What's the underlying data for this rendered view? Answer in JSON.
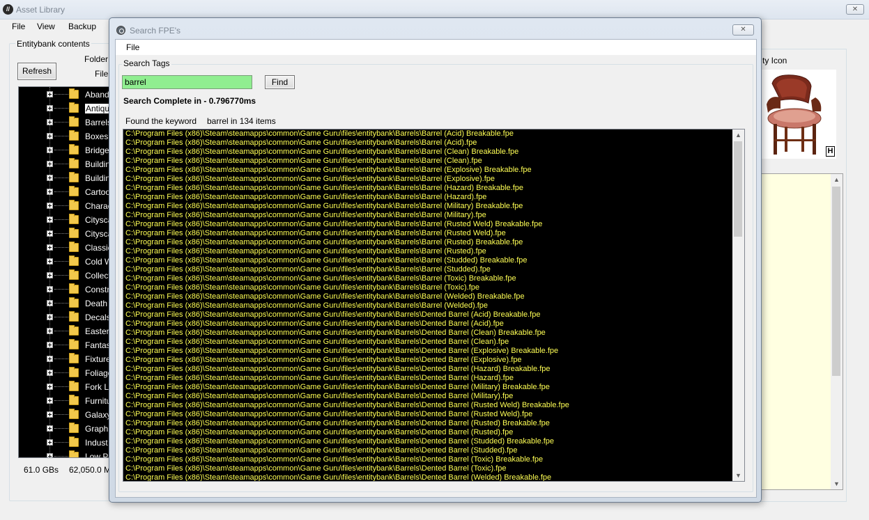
{
  "main_window": {
    "title": "Asset Library",
    "close_glyph": "✕",
    "menu": [
      "File",
      "View",
      "Backup"
    ]
  },
  "entitybank": {
    "group_label": "Entitybank contents",
    "refresh_label": "Refresh",
    "folder_label": "Folder",
    "file_label": "File",
    "tree_items": [
      {
        "label": "Aband",
        "selected": false
      },
      {
        "label": "Antiqu",
        "selected": true
      },
      {
        "label": "Barrels",
        "selected": false
      },
      {
        "label": "Boxes",
        "selected": false
      },
      {
        "label": "Bridge",
        "selected": false
      },
      {
        "label": "Buildin",
        "selected": false
      },
      {
        "label": "Buildin",
        "selected": false
      },
      {
        "label": "Cartoo",
        "selected": false
      },
      {
        "label": "Charac",
        "selected": false
      },
      {
        "label": "Citysca",
        "selected": false
      },
      {
        "label": "Citysca",
        "selected": false
      },
      {
        "label": "Classic",
        "selected": false
      },
      {
        "label": "Cold W",
        "selected": false
      },
      {
        "label": "Collect",
        "selected": false
      },
      {
        "label": "Constr",
        "selected": false
      },
      {
        "label": "Death",
        "selected": false
      },
      {
        "label": "Decals",
        "selected": false
      },
      {
        "label": "Easter",
        "selected": false
      },
      {
        "label": "Fantas",
        "selected": false
      },
      {
        "label": "Fixture",
        "selected": false
      },
      {
        "label": "Foliage",
        "selected": false
      },
      {
        "label": "Fork Li",
        "selected": false
      },
      {
        "label": "Furnitu",
        "selected": false
      },
      {
        "label": "Galaxy",
        "selected": false
      },
      {
        "label": "Graphi",
        "selected": false
      },
      {
        "label": "Indust",
        "selected": false
      },
      {
        "label": "Low Po",
        "selected": false
      }
    ],
    "status_gb": "61.0  GBs",
    "status_mb": "62,050.0  M"
  },
  "entity_panel": {
    "icon_label": "ty Icon",
    "preview_badge": "H"
  },
  "search_dialog": {
    "title": "Search FPE's",
    "close_glyph": "✕",
    "menu_file": "File",
    "tags_label": "Search Tags",
    "search_value": "barrel",
    "find_label": "Find",
    "status": "Search Complete in - 0.796770ms",
    "found_prefix": "Found the keyword",
    "found_suffix": "barrel in 134 items",
    "results": [
      "C:\\Program Files (x86)\\Steam\\steamapps\\common\\Game Guru\\files\\entitybank\\Barrels\\Barrel (Acid) Breakable.fpe",
      "C:\\Program Files (x86)\\Steam\\steamapps\\common\\Game Guru\\files\\entitybank\\Barrels\\Barrel (Acid).fpe",
      "C:\\Program Files (x86)\\Steam\\steamapps\\common\\Game Guru\\files\\entitybank\\Barrels\\Barrel (Clean) Breakable.fpe",
      "C:\\Program Files (x86)\\Steam\\steamapps\\common\\Game Guru\\files\\entitybank\\Barrels\\Barrel (Clean).fpe",
      "C:\\Program Files (x86)\\Steam\\steamapps\\common\\Game Guru\\files\\entitybank\\Barrels\\Barrel (Explosive) Breakable.fpe",
      "C:\\Program Files (x86)\\Steam\\steamapps\\common\\Game Guru\\files\\entitybank\\Barrels\\Barrel (Explosive).fpe",
      "C:\\Program Files (x86)\\Steam\\steamapps\\common\\Game Guru\\files\\entitybank\\Barrels\\Barrel (Hazard) Breakable.fpe",
      "C:\\Program Files (x86)\\Steam\\steamapps\\common\\Game Guru\\files\\entitybank\\Barrels\\Barrel (Hazard).fpe",
      "C:\\Program Files (x86)\\Steam\\steamapps\\common\\Game Guru\\files\\entitybank\\Barrels\\Barrel (Military) Breakable.fpe",
      "C:\\Program Files (x86)\\Steam\\steamapps\\common\\Game Guru\\files\\entitybank\\Barrels\\Barrel (Military).fpe",
      "C:\\Program Files (x86)\\Steam\\steamapps\\common\\Game Guru\\files\\entitybank\\Barrels\\Barrel (Rusted Weld) Breakable.fpe",
      "C:\\Program Files (x86)\\Steam\\steamapps\\common\\Game Guru\\files\\entitybank\\Barrels\\Barrel (Rusted Weld).fpe",
      "C:\\Program Files (x86)\\Steam\\steamapps\\common\\Game Guru\\files\\entitybank\\Barrels\\Barrel (Rusted) Breakable.fpe",
      "C:\\Program Files (x86)\\Steam\\steamapps\\common\\Game Guru\\files\\entitybank\\Barrels\\Barrel (Rusted).fpe",
      "C:\\Program Files (x86)\\Steam\\steamapps\\common\\Game Guru\\files\\entitybank\\Barrels\\Barrel (Studded) Breakable.fpe",
      "C:\\Program Files (x86)\\Steam\\steamapps\\common\\Game Guru\\files\\entitybank\\Barrels\\Barrel (Studded).fpe",
      "C:\\Program Files (x86)\\Steam\\steamapps\\common\\Game Guru\\files\\entitybank\\Barrels\\Barrel (Toxic) Breakable.fpe",
      "C:\\Program Files (x86)\\Steam\\steamapps\\common\\Game Guru\\files\\entitybank\\Barrels\\Barrel (Toxic).fpe",
      "C:\\Program Files (x86)\\Steam\\steamapps\\common\\Game Guru\\files\\entitybank\\Barrels\\Barrel (Welded) Breakable.fpe",
      "C:\\Program Files (x86)\\Steam\\steamapps\\common\\Game Guru\\files\\entitybank\\Barrels\\Barrel (Welded).fpe",
      "C:\\Program Files (x86)\\Steam\\steamapps\\common\\Game Guru\\files\\entitybank\\Barrels\\Dented Barrel (Acid) Breakable.fpe",
      "C:\\Program Files (x86)\\Steam\\steamapps\\common\\Game Guru\\files\\entitybank\\Barrels\\Dented Barrel (Acid).fpe",
      "C:\\Program Files (x86)\\Steam\\steamapps\\common\\Game Guru\\files\\entitybank\\Barrels\\Dented Barrel (Clean) Breakable.fpe",
      "C:\\Program Files (x86)\\Steam\\steamapps\\common\\Game Guru\\files\\entitybank\\Barrels\\Dented Barrel (Clean).fpe",
      "C:\\Program Files (x86)\\Steam\\steamapps\\common\\Game Guru\\files\\entitybank\\Barrels\\Dented Barrel (Explosive) Breakable.fpe",
      "C:\\Program Files (x86)\\Steam\\steamapps\\common\\Game Guru\\files\\entitybank\\Barrels\\Dented Barrel (Explosive).fpe",
      "C:\\Program Files (x86)\\Steam\\steamapps\\common\\Game Guru\\files\\entitybank\\Barrels\\Dented Barrel (Hazard) Breakable.fpe",
      "C:\\Program Files (x86)\\Steam\\steamapps\\common\\Game Guru\\files\\entitybank\\Barrels\\Dented Barrel (Hazard).fpe",
      "C:\\Program Files (x86)\\Steam\\steamapps\\common\\Game Guru\\files\\entitybank\\Barrels\\Dented Barrel (Military) Breakable.fpe",
      "C:\\Program Files (x86)\\Steam\\steamapps\\common\\Game Guru\\files\\entitybank\\Barrels\\Dented Barrel (Military).fpe",
      "C:\\Program Files (x86)\\Steam\\steamapps\\common\\Game Guru\\files\\entitybank\\Barrels\\Dented Barrel (Rusted Weld) Breakable.fpe",
      "C:\\Program Files (x86)\\Steam\\steamapps\\common\\Game Guru\\files\\entitybank\\Barrels\\Dented Barrel (Rusted Weld).fpe",
      "C:\\Program Files (x86)\\Steam\\steamapps\\common\\Game Guru\\files\\entitybank\\Barrels\\Dented Barrel (Rusted) Breakable.fpe",
      "C:\\Program Files (x86)\\Steam\\steamapps\\common\\Game Guru\\files\\entitybank\\Barrels\\Dented Barrel (Rusted).fpe",
      "C:\\Program Files (x86)\\Steam\\steamapps\\common\\Game Guru\\files\\entitybank\\Barrels\\Dented Barrel (Studded) Breakable.fpe",
      "C:\\Program Files (x86)\\Steam\\steamapps\\common\\Game Guru\\files\\entitybank\\Barrels\\Dented Barrel (Studded).fpe",
      "C:\\Program Files (x86)\\Steam\\steamapps\\common\\Game Guru\\files\\entitybank\\Barrels\\Dented Barrel (Toxic) Breakable.fpe",
      "C:\\Program Files (x86)\\Steam\\steamapps\\common\\Game Guru\\files\\entitybank\\Barrels\\Dented Barrel (Toxic).fpe",
      "C:\\Program Files (x86)\\Steam\\steamapps\\common\\Game Guru\\files\\entitybank\\Barrels\\Dented Barrel (Welded) Breakable.fpe"
    ],
    "result_color": "#ffff54",
    "search_field_color": "#90ee90"
  }
}
